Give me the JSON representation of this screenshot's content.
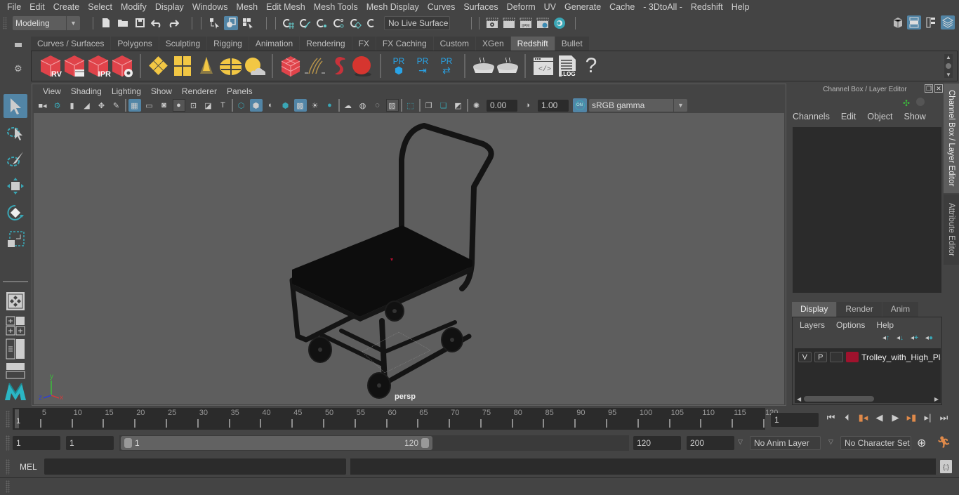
{
  "menubar": {
    "items": [
      "File",
      "Edit",
      "Create",
      "Select",
      "Modify",
      "Display",
      "Windows",
      "Mesh",
      "Edit Mesh",
      "Mesh Tools",
      "Mesh Display",
      "Curves",
      "Surfaces",
      "Deform",
      "UV",
      "Generate",
      "Cache",
      "- 3DtoAll -",
      "Redshift",
      "Help"
    ]
  },
  "statusline": {
    "menuset": "Modeling",
    "live_surface": "No Live Surface",
    "render_icons": [
      "render-view-icon",
      "render-frame-icon",
      "ipr-render-icon",
      "render-settings-icon",
      "hypershade-icon"
    ],
    "right_icons": [
      "modeling-toolkit-icon",
      "attribute-editor-icon",
      "tool-settings-icon",
      "channel-box-icon"
    ]
  },
  "shelf": {
    "tabs": [
      "Curves / Surfaces",
      "Polygons",
      "Sculpting",
      "Rigging",
      "Animation",
      "Rendering",
      "FX",
      "FX Caching",
      "Custom",
      "XGen",
      "Redshift",
      "Bullet"
    ],
    "active_tab": "Redshift",
    "icons": {
      "rv": "RV",
      "ipr": "IPR",
      "pr": "PR",
      "log": ".LOG",
      "help": "?"
    }
  },
  "viewport": {
    "menus": [
      "View",
      "Shading",
      "Lighting",
      "Show",
      "Renderer",
      "Panels"
    ],
    "exposure": "0.00",
    "gamma": "1.00",
    "color_management": "ON",
    "color_space": "sRGB gamma",
    "camera_label": "persp",
    "axis_labels": {
      "x": "x",
      "y": "y",
      "z": "z"
    },
    "object_name": "Trolley_with_High_Platform"
  },
  "channelbox": {
    "title": "Channel Box / Layer Editor",
    "menus": [
      "Channels",
      "Edit",
      "Object",
      "Show"
    ],
    "layer_tabs": [
      "Display",
      "Render",
      "Anim"
    ],
    "active_layer_tab": "Display",
    "layer_menus": [
      "Layers",
      "Options",
      "Help"
    ],
    "layers": [
      {
        "v": "V",
        "p": "P",
        "color": "#a0122d",
        "name": "Trolley_with_High_Plat"
      }
    ]
  },
  "side_tabs": {
    "channel_box": "Channel Box / Layer Editor",
    "attribute_editor": "Attribute Editor"
  },
  "timeslider": {
    "ticks": [
      5,
      10,
      15,
      20,
      25,
      30,
      35,
      40,
      45,
      50,
      55,
      60,
      65,
      70,
      75,
      80,
      85,
      90,
      95,
      100,
      105,
      110,
      115,
      120
    ],
    "current_frame_marker": "1",
    "current_frame": "1",
    "range_max": 120
  },
  "range": {
    "start": "1",
    "playback_start": "1",
    "slider_start": "1",
    "slider_end": "120",
    "playback_end": "120",
    "end": "200",
    "anim_layer": "No Anim Layer",
    "character_set": "No Character Set"
  },
  "commandline": {
    "label": "MEL"
  },
  "colors": {
    "accent": "#5285a6",
    "redshift_red": "#e0434a",
    "yellow_icon": "#f2c744",
    "pr_blue": "#29a3e6",
    "layer_color": "#a0122d",
    "key_orange": "#e08a4a"
  }
}
